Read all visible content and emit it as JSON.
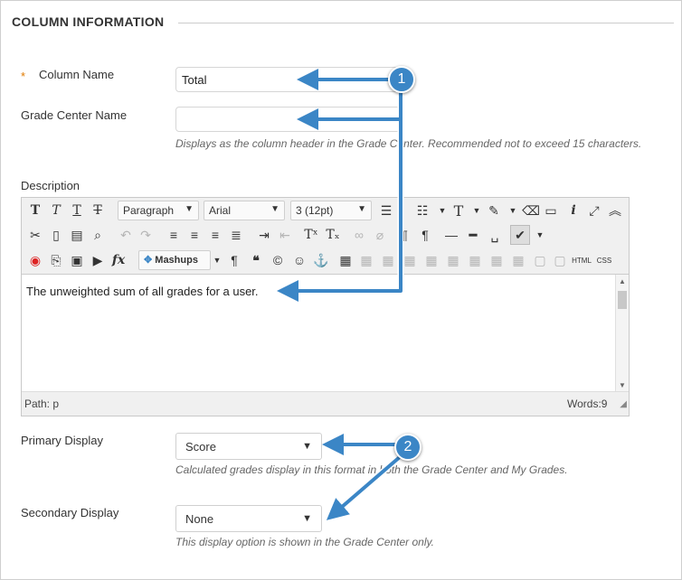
{
  "section": {
    "title": "COLUMN INFORMATION"
  },
  "column_name": {
    "required_mark": "*",
    "label": "Column Name",
    "value": "Total"
  },
  "grade_center_name": {
    "label": "Grade Center Name",
    "value": "",
    "hint": "Displays as the column header in the Grade Center. Recommended not to exceed 15 characters."
  },
  "description": {
    "label": "Description",
    "toolbar": {
      "format_select": "Paragraph",
      "font_select": "Arial",
      "size_select": "3 (12pt)",
      "mashups_label": "Mashups",
      "html_label": "HTML",
      "css_label": "CSS"
    },
    "content": "The unweighted sum of all grades for a user.",
    "path_label": "Path: p",
    "word_count": "Words:9"
  },
  "primary_display": {
    "label": "Primary Display",
    "selected": "Score",
    "hint": "Calculated grades display in this format in both the Grade Center and My Grades."
  },
  "secondary_display": {
    "label": "Secondary Display",
    "selected": "None",
    "hint": "This display option is shown in the Grade Center only."
  },
  "callouts": {
    "one": "1",
    "two": "2"
  },
  "colors": {
    "accent": "#3b86c6",
    "required": "#e07b00"
  }
}
